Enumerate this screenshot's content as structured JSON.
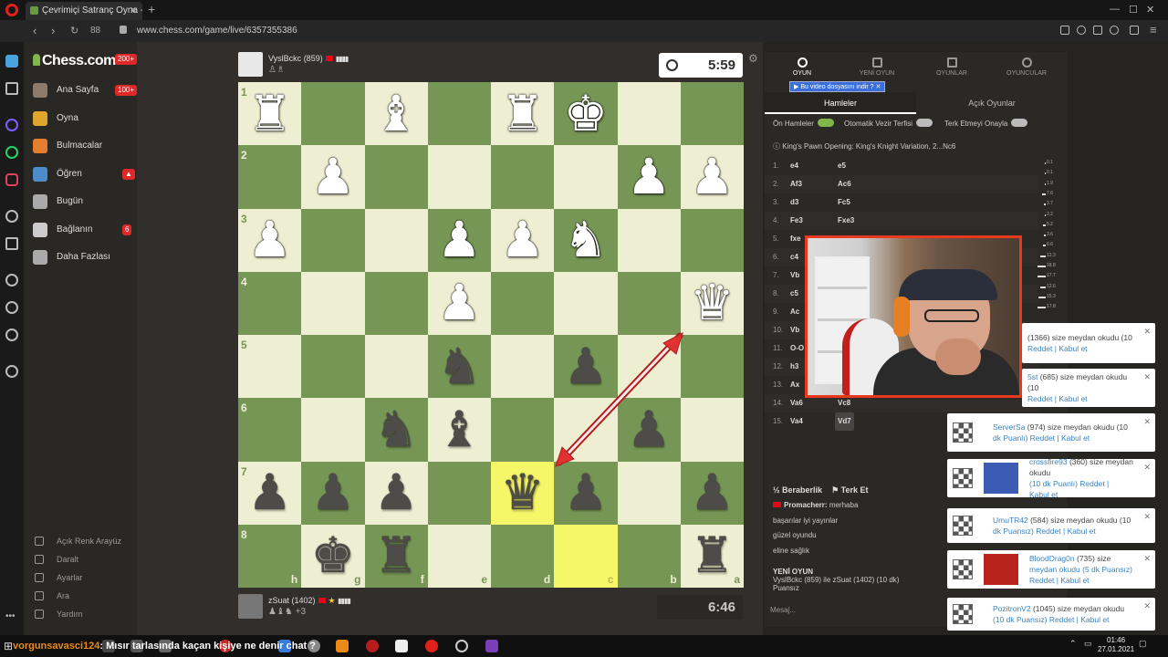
{
  "browser": {
    "tab_title": "Çevrimiçi Satranç Oyna - C",
    "url": "www.chess.com/game/live/6357355386",
    "tab_count": "88"
  },
  "site_nav": {
    "logo": "Chess.com",
    "logo_badge": "200+",
    "items": [
      {
        "label": "Ana Sayfa",
        "badge": "100+",
        "icon": "home-icon",
        "color": "#8c7b6a"
      },
      {
        "label": "Oyna",
        "badge": "",
        "icon": "pawn-icon",
        "color": "#e0a52c"
      },
      {
        "label": "Bulmacalar",
        "badge": "",
        "icon": "puzzle-icon",
        "color": "#e57c30"
      },
      {
        "label": "Öğren",
        "badge": "▲",
        "icon": "learn-icon",
        "color": "#4c8cc9"
      },
      {
        "label": "Bugün",
        "badge": "",
        "icon": "news-icon",
        "color": "#aaaaaa"
      },
      {
        "label": "Bağlanın",
        "badge": "6",
        "icon": "people-icon",
        "color": "#cccccc"
      },
      {
        "label": "Daha Fazlası",
        "badge": "",
        "icon": "more-icon",
        "color": "#aaaaaa"
      }
    ],
    "bottom": [
      "Açık Renk Arayüz",
      "Daralt",
      "Ayarlar",
      "Ara",
      "Yardım"
    ]
  },
  "game": {
    "top_player": {
      "name": "VyslBckc",
      "rating": "(859)"
    },
    "bottom_player": {
      "name": "zSuat",
      "rating": "(1402)",
      "material": "+3"
    },
    "top_clock": "5:59",
    "bottom_clock": "6:46",
    "ranks": [
      "1",
      "2",
      "3",
      "4",
      "5",
      "6",
      "7",
      "8"
    ],
    "files": [
      "h",
      "g",
      "f",
      "e",
      "d",
      "c",
      "b",
      "a"
    ],
    "board": [
      [
        "wR",
        "",
        "wB",
        "",
        "wR",
        "wK",
        "",
        ""
      ],
      [
        "",
        "wP",
        "",
        "",
        "",
        "",
        "wP",
        "wP"
      ],
      [
        "wP",
        "",
        "",
        "wP",
        "wP",
        "wN",
        "",
        ""
      ],
      [
        "",
        "",
        "",
        "wP",
        "",
        "",
        "",
        "wQ"
      ],
      [
        "",
        "",
        "",
        "bN",
        "",
        "bP",
        "",
        ""
      ],
      [
        "",
        "",
        "bN",
        "bB",
        "",
        "",
        "bP",
        ""
      ],
      [
        "bP",
        "bP",
        "bP",
        "",
        "bQ",
        "bP",
        "",
        "bP"
      ],
      [
        "",
        "bK",
        "bR",
        "",
        "",
        "",
        "",
        "bR"
      ]
    ],
    "highlights": [
      [
        6,
        4
      ],
      [
        7,
        5
      ]
    ],
    "arrow_color": "#e03030"
  },
  "panel": {
    "top_tabs": [
      "OYUN",
      "YENİ OYUN",
      "OYUNLAR",
      "OYUNCULAR"
    ],
    "download_banner": "Bu video dosyasını indir",
    "sub_tabs": [
      "Hamleler",
      "Açık Oyunlar"
    ],
    "toggles": [
      "Ön Hamleler",
      "Otomatik Vezir Terfisi",
      "Terk Etmeyi Onayla"
    ],
    "opening": "King's Pawn Opening: King's Knight Variation, 2...Nc6",
    "moves": [
      {
        "n": "1.",
        "w": "e4",
        "b": "e5"
      },
      {
        "n": "2.",
        "w": "Af3",
        "b": "Ac6"
      },
      {
        "n": "3.",
        "w": "d3",
        "b": "Fc5"
      },
      {
        "n": "4.",
        "w": "Fe3",
        "b": "Fxe3"
      },
      {
        "n": "5.",
        "w": "fxe",
        "b": ""
      },
      {
        "n": "6.",
        "w": "c4",
        "b": ""
      },
      {
        "n": "7.",
        "w": "Vb",
        "b": ""
      },
      {
        "n": "8.",
        "w": "c5",
        "b": ""
      },
      {
        "n": "9.",
        "w": "Ac",
        "b": ""
      },
      {
        "n": "10.",
        "w": "Vb",
        "b": ""
      },
      {
        "n": "11.",
        "w": "O-O",
        "b": ""
      },
      {
        "n": "12.",
        "w": "h3",
        "b": ""
      },
      {
        "n": "13.",
        "w": "Ax",
        "b": ""
      },
      {
        "n": "14.",
        "w": "Va6",
        "b": "Vc8"
      },
      {
        "n": "15.",
        "w": "Va4",
        "b": "Vd7"
      }
    ],
    "evals": [
      "0.1",
      "0.1",
      "1.9",
      "7.6",
      "3.7",
      "2.2",
      "5.2",
      "3.6",
      "6.6",
      "12.3",
      "18.8",
      "17.7",
      "12.6",
      "15.3",
      "17.8"
    ],
    "draw_label": "Beraberlik",
    "resign_label": "Terk Et",
    "chat": [
      {
        "user": "Promacherr:",
        "text": "merhaba"
      },
      {
        "user": "",
        "text": "başarılar iyi yayınlar"
      },
      {
        "user": "",
        "text": "güzel oyundu"
      },
      {
        "user": "",
        "text": "eline sağlık"
      }
    ],
    "new_game_title": "YENİ OYUN",
    "new_game_line1": "VyslBckc (859) ile zSuat (1402) (10 dk)",
    "new_game_line2": "Puansız",
    "message_placeholder": "Mesaj..."
  },
  "notifications": [
    {
      "user": "",
      "text": "(1366) size meydan okudu (10",
      "text2": "Reddet | Kabul et",
      "icon": false,
      "avatar": ""
    },
    {
      "user": "5st",
      "text": " (685) size meydan okudu (10",
      "text2": "Reddet | Kabul et",
      "icon": false,
      "avatar": ""
    },
    {
      "user": "ServerSa",
      "text": " (974) size meydan okudu (10",
      "text2": "dk Puanlı) Reddet | Kabul et",
      "icon": true,
      "avatar": ""
    },
    {
      "user": "crossfire93",
      "text": " (360) size meydan okudu",
      "text2": "(10 dk Puanlı) Reddet |",
      "text3": "Kabul et",
      "icon": true,
      "avatar": "#3b5bb5"
    },
    {
      "user": "UmuTR42",
      "text": " (584) size meydan okudu (10",
      "text2": "dk Puansız) Reddet | Kabul et",
      "icon": true,
      "avatar": ""
    },
    {
      "user": "BloodDrag0n",
      "text": " (735) size",
      "text2": "meydan okudu (5 dk Puansız)",
      "text3": "Reddet | Kabul et",
      "icon": true,
      "avatar": "#b8231c"
    },
    {
      "user": "PozitronV2",
      "text": " (1045) size meydan okudu",
      "text2": "(10 dk Puansız) Reddet | Kabul et",
      "icon": true,
      "avatar": ""
    }
  ],
  "ticker": {
    "user": "vorgunsavasci124",
    "message": "Mısır tarlasında kaçan kişiye ne denir chat ?"
  },
  "taskbar": {
    "time": "01:46",
    "date": "27.01.2021"
  }
}
